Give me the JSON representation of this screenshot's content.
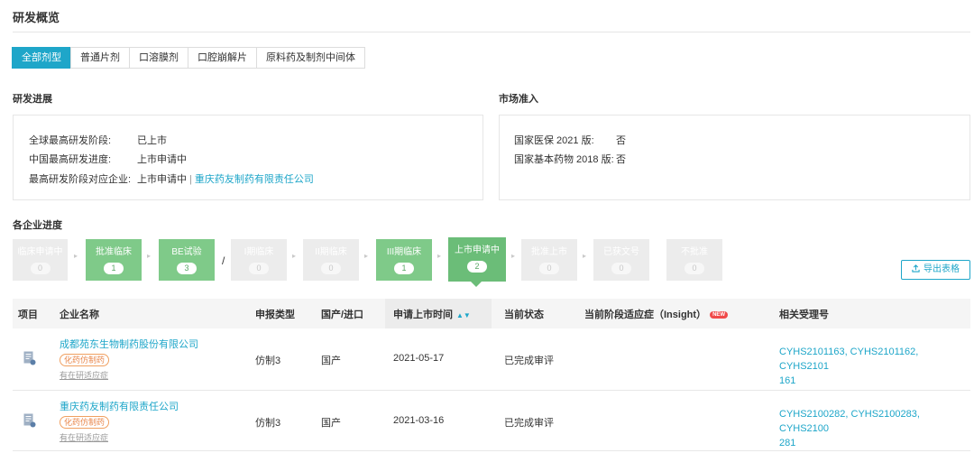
{
  "page": {
    "title": "研发概览"
  },
  "tabs": [
    "全部剂型",
    "普通片剂",
    "口溶膜剂",
    "口腔崩解片",
    "原料药及制剂中间体"
  ],
  "rd_progress": {
    "title": "研发进展",
    "rows": [
      {
        "label": "全球最高研发阶段:",
        "value": "已上市"
      },
      {
        "label": "中国最高研发进度:",
        "value": "上市申请中"
      },
      {
        "label": "最高研发阶段对应企业:",
        "value": "上市申请中",
        "sep": "|",
        "company": "重庆药友制药有限责任公司"
      }
    ]
  },
  "market": {
    "title": "市场准入",
    "rows": [
      {
        "label": "国家医保 2021 版:",
        "value": "否"
      },
      {
        "label": "国家基本药物 2018 版:",
        "value": "否"
      }
    ]
  },
  "companies": {
    "title": "各企业进度",
    "stages": [
      {
        "name": "临床申请中",
        "count": "0"
      },
      {
        "name": "批准临床",
        "count": "1"
      },
      {
        "name": "BE试验",
        "count": "3"
      },
      {
        "name": "I期临床",
        "count": "0"
      },
      {
        "name": "II期临床",
        "count": "0"
      },
      {
        "name": "III期临床",
        "count": "1"
      },
      {
        "name": "上市申请中",
        "count": "2"
      },
      {
        "name": "批准上市",
        "count": "0"
      },
      {
        "name": "已获文号",
        "count": "0"
      },
      {
        "name": "不批准",
        "count": "0"
      }
    ],
    "slash": "/",
    "export_label": "导出表格",
    "export_icon": "upload-icon"
  },
  "table": {
    "headers": [
      "项目",
      "企业名称",
      "申报类型",
      "国产/进口",
      "申请上市时间",
      "当前状态",
      "当前阶段适应症（Insight）",
      "相关受理号"
    ],
    "new_badge": "NEW",
    "rows": [
      {
        "company": "成都苑东生物制药股份有限公司",
        "tag": "化药仿制药",
        "sub": "有在研适应症",
        "type": "仿制3",
        "origin": "国产",
        "date": "2021-05-17",
        "status": "已完成审评",
        "insight": "",
        "numbers_line1": "CYHS2101163, CYHS2101162, CYHS2101",
        "numbers_line2": "161"
      },
      {
        "company": "重庆药友制药有限责任公司",
        "tag": "化药仿制药",
        "sub": "有在研适应症",
        "type": "仿制3",
        "origin": "国产",
        "date": "2021-03-16",
        "status": "已完成审评",
        "insight": "",
        "numbers_line1": "CYHS2100282, CYHS2100283, CYHS2100",
        "numbers_line2": "281"
      }
    ]
  },
  "colors": {
    "accent": "#1ea6c9",
    "stage_green": "#7fca89",
    "stage_current": "#6bbd78",
    "stage_gray": "#ececec",
    "tag_orange": "#e8864a"
  }
}
